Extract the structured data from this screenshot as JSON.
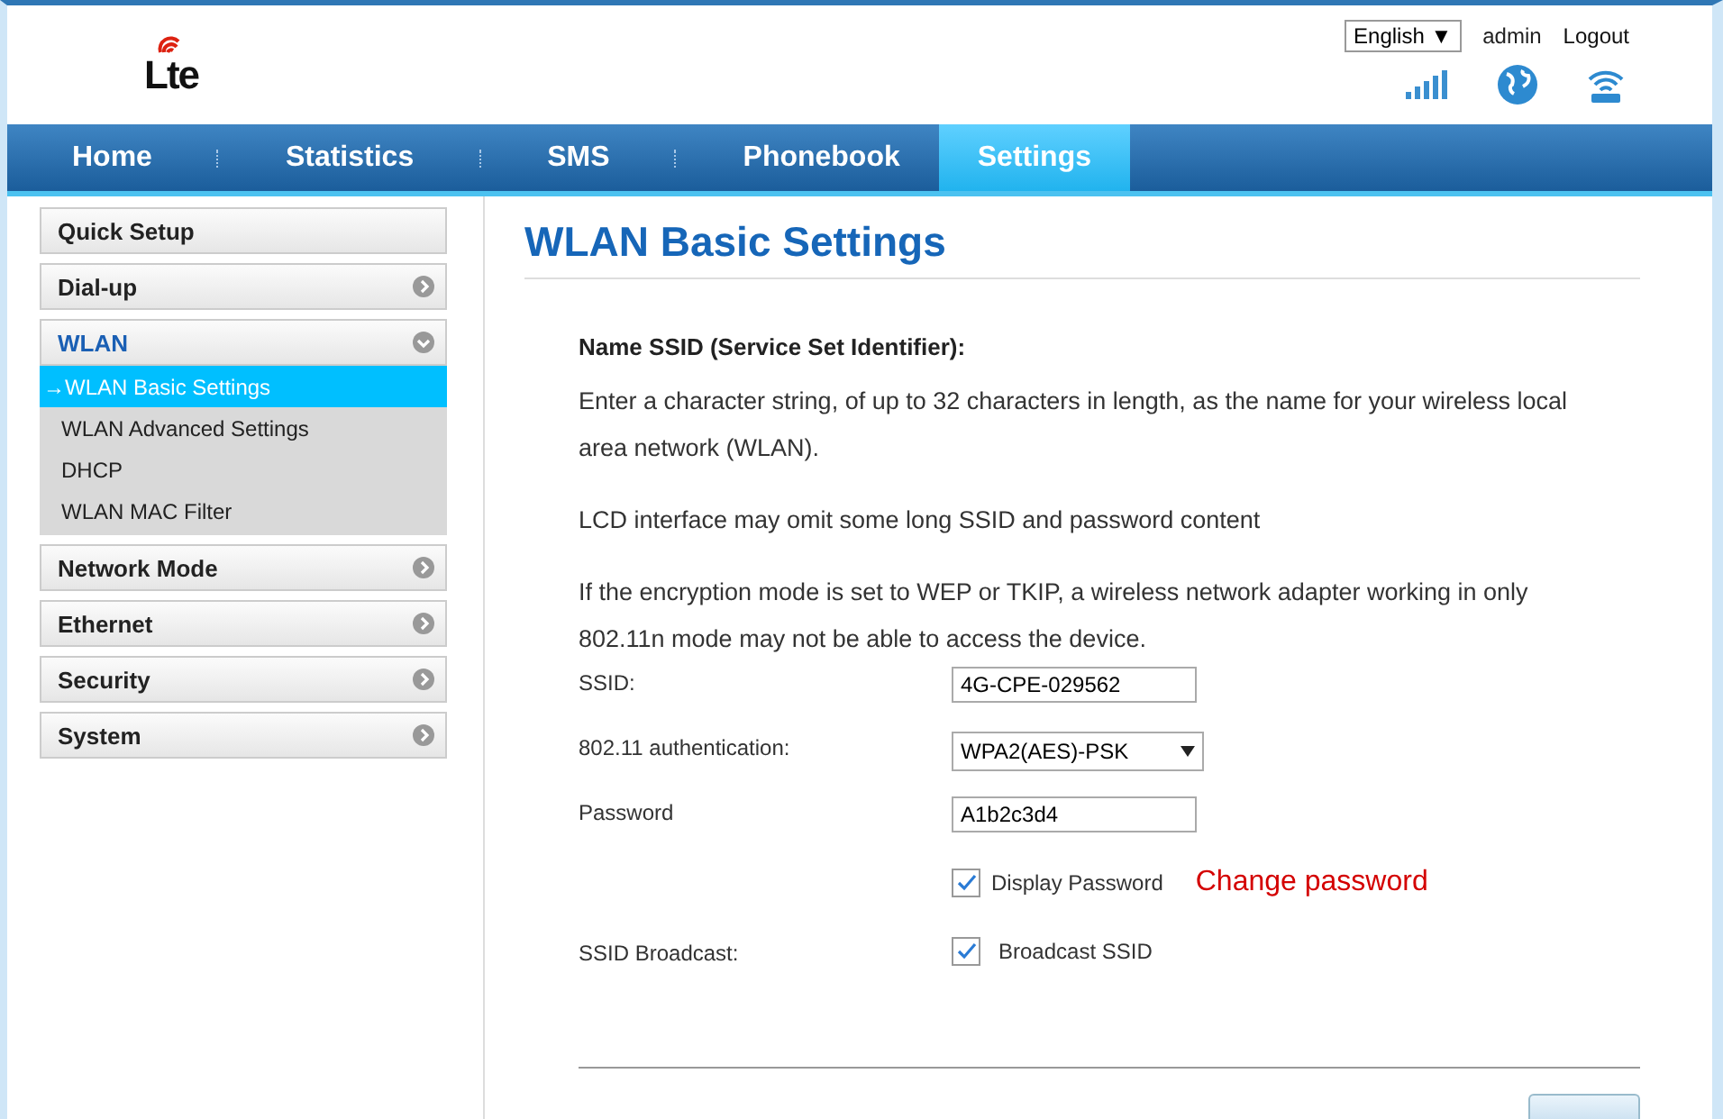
{
  "header": {
    "logo": "Lte",
    "language": "English ▼",
    "user": "admin",
    "logout": "Logout"
  },
  "nav": [
    {
      "label": "Home",
      "selected": false
    },
    {
      "label": "Statistics",
      "selected": false
    },
    {
      "label": "SMS",
      "selected": false
    },
    {
      "label": "Phonebook",
      "selected": false
    },
    {
      "label": "Settings",
      "selected": true
    }
  ],
  "sidebar": [
    {
      "label": "Quick Setup",
      "kind": "plain",
      "expanded": false
    },
    {
      "label": "Dial-up",
      "kind": "group",
      "expanded": false
    },
    {
      "label": "WLAN",
      "kind": "group",
      "expanded": true,
      "children": [
        {
          "label": "→WLAN Basic Settings",
          "selected": true
        },
        {
          "label": "WLAN Advanced Settings",
          "selected": false
        },
        {
          "label": "DHCP",
          "selected": false
        },
        {
          "label": "WLAN MAC Filter",
          "selected": false
        }
      ]
    },
    {
      "label": "Network Mode",
      "kind": "group",
      "expanded": false
    },
    {
      "label": "Ethernet",
      "kind": "group",
      "expanded": false
    },
    {
      "label": "Security",
      "kind": "group",
      "expanded": false
    },
    {
      "label": "System",
      "kind": "group",
      "expanded": false
    }
  ],
  "page_title": "WLAN Basic Settings",
  "section_heading": "Name SSID (Service Set Identifier):",
  "paragraphs": [
    "Enter a character string, of up to 32 characters in length, as the name for your wireless local area network (WLAN).",
    "LCD interface may omit some long SSID and password content",
    "If the encryption mode is set to WEP or TKIP, a wireless network adapter working in only 802.11n mode may not be able to access the device."
  ],
  "form": {
    "ssid_label": "SSID:",
    "ssid": "4G-CPE-029562",
    "auth_label": "802.11 authentication:",
    "auth": "WPA2(AES)-PSK",
    "password_label": "Password",
    "password": "A1b2c3d4",
    "display_password": {
      "label": "Display Password",
      "checked": true
    },
    "change_password": "Change password",
    "broadcast_label": "SSID Broadcast:",
    "broadcast": {
      "label": "Broadcast SSID",
      "checked": true
    }
  }
}
